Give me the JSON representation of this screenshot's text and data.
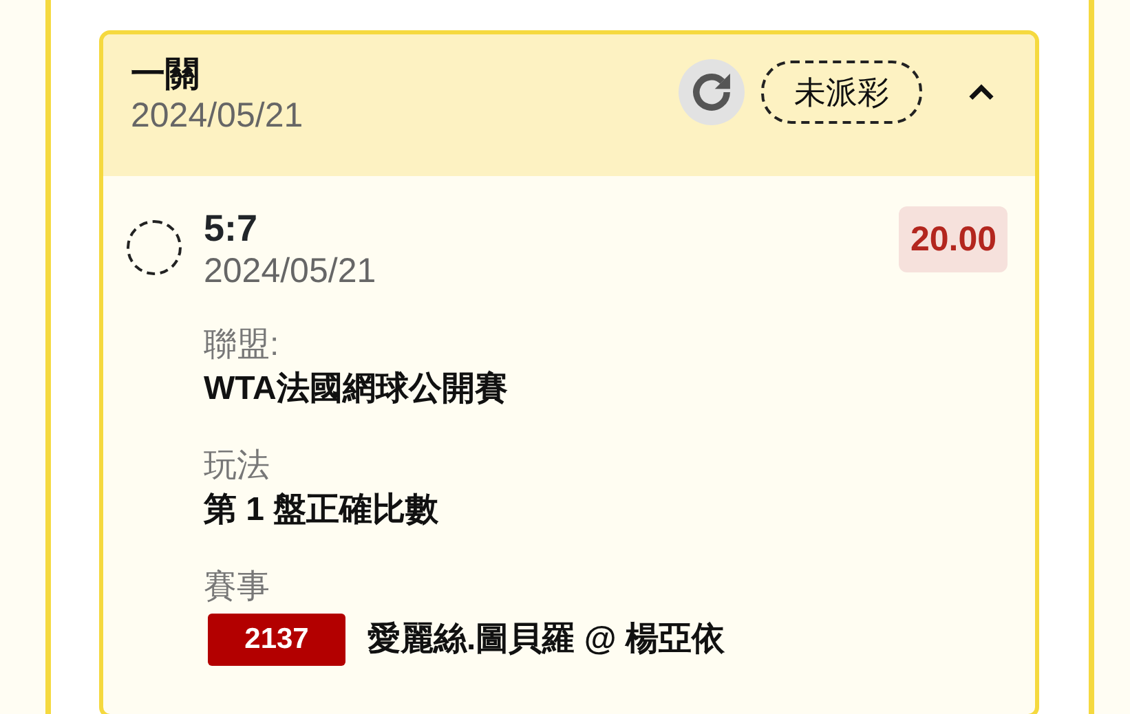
{
  "bet": {
    "title": "一關",
    "date": "2024/05/21",
    "status": "未派彩",
    "expanded": true,
    "selections": [
      {
        "selected": false,
        "pick": "5:7",
        "date": "2024/05/21",
        "odds": "20.00",
        "fields": [
          {
            "kind": "text",
            "label": "聯盟:",
            "value": "WTA法國網球公開賽"
          },
          {
            "kind": "text",
            "label": "玩法",
            "value": "第 1 盤正確比數"
          },
          {
            "kind": "match",
            "label": "賽事",
            "match_no": "2137",
            "value": "愛麗絲.圖貝羅 @ 楊亞依"
          }
        ]
      }
    ]
  }
}
